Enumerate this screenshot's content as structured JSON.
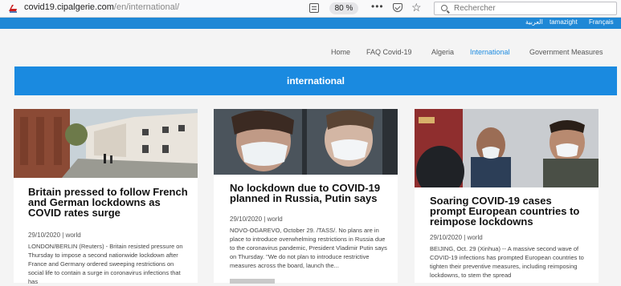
{
  "browser": {
    "url_domain": "covid19.cipalgerie.com",
    "url_path": "/en/international/",
    "zoom": "80 %",
    "search_placeholder": "Rechercher"
  },
  "languages": [
    "العربية",
    "tamazight",
    "Français"
  ],
  "nav": [
    "Home",
    "FAQ Covid-19",
    "Algeria",
    "International",
    "Government Measures"
  ],
  "nav_active": "International",
  "banner_title": "international",
  "accent_color": "#1a8ae0",
  "articles": [
    {
      "title": "Britain pressed to follow French and German lockdowns as COVID rates surge",
      "meta": "29/10/2020 | world",
      "body": "LONDON/BERLIN (Reuters) - Britain resisted pressure on Thursday to impose a second nationwide lockdown after France and Germany ordered sweeping restrictions on social life to contain a surge in coronavirus infections that has"
    },
    {
      "title": "No lockdown due to COVID-19 planned in Russia, Putin says",
      "meta": "29/10/2020 | world",
      "body": "NOVO-OGAREVO, October 29. /TASS/. No plans are in place to introduce overwhelming restrictions in Russia due to the coronavirus pandemic, President Vladimir Putin says on Thursday. \"We do not plan to introduce restrictive measures across the board, launch the..."
    },
    {
      "title": "Soaring COVID-19 cases prompt European countries to reimpose lockdowns",
      "meta": "29/10/2020 | world",
      "body": "BEIJING, Oct. 29 (Xinhua) -- A massive second wave of COVID-19 infections has prompted European countries to tighten their preventive measures, including reimposing lockdowns, to stem the spread"
    }
  ]
}
